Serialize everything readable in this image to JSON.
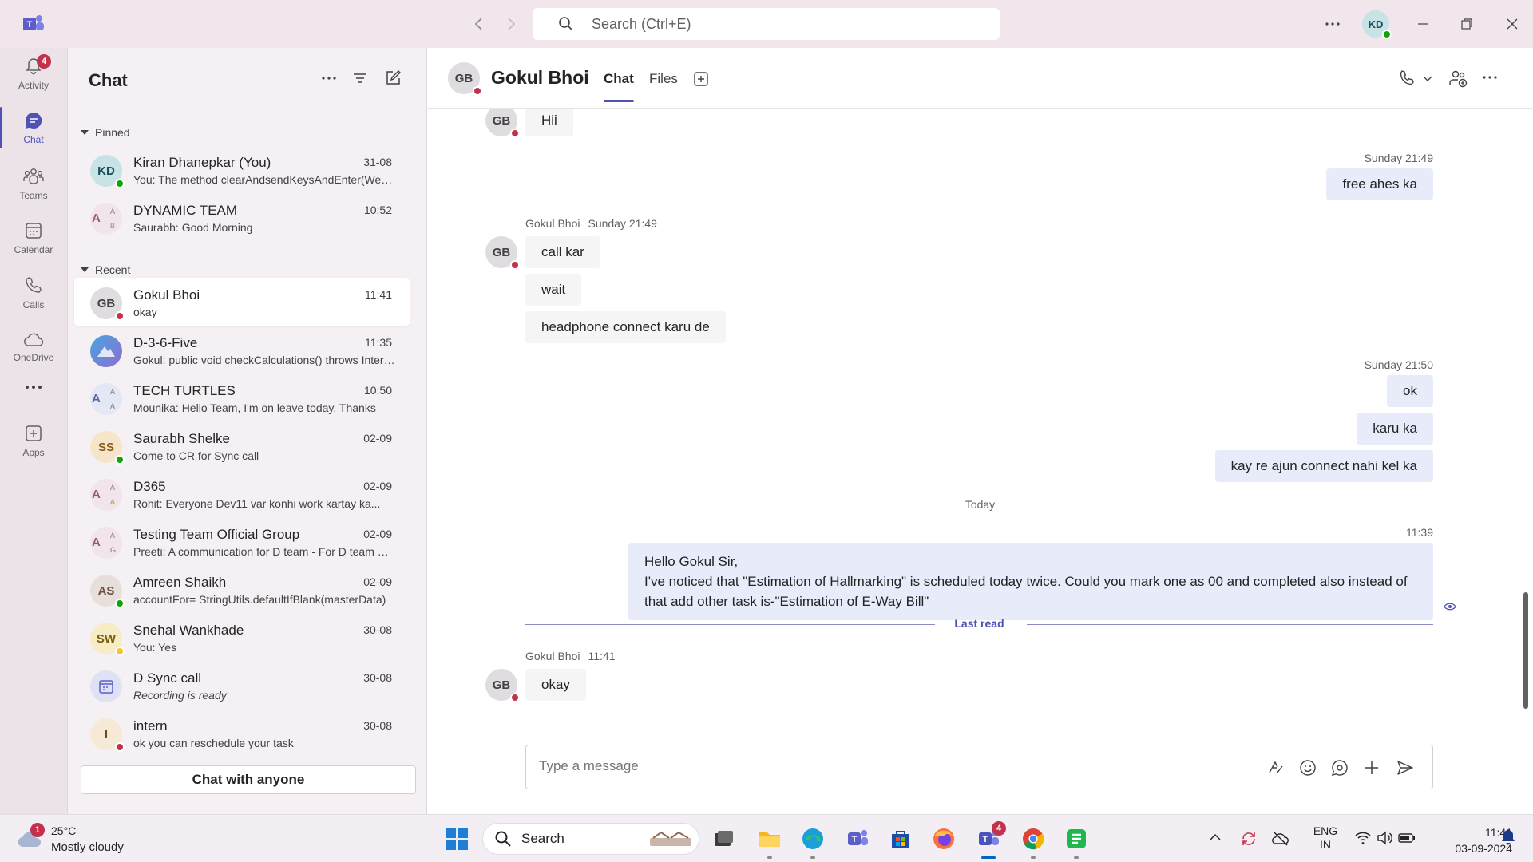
{
  "titlebar": {
    "search_placeholder": "Search (Ctrl+E)",
    "avatar_initials": "KD"
  },
  "rail": {
    "items": [
      {
        "label": "Activity",
        "badge": "4"
      },
      {
        "label": "Chat"
      },
      {
        "label": "Teams"
      },
      {
        "label": "Calendar"
      },
      {
        "label": "Calls"
      },
      {
        "label": "OneDrive"
      },
      {
        "label": "Apps"
      }
    ]
  },
  "chat_panel": {
    "title": "Chat",
    "pinned_label": "Pinned",
    "recent_label": "Recent",
    "pinned": [
      {
        "initials": "KD",
        "name": "Kiran Dhanepkar (You)",
        "time": "31-08",
        "preview": "You: The method clearAndsendKeysAndEnter(WebElement..."
      },
      {
        "initials": "A",
        "name": "DYNAMIC TEAM",
        "time": "10:52",
        "preview": "Saurabh: Good Morning"
      }
    ],
    "recent": [
      {
        "initials": "GB",
        "name": "Gokul Bhoi",
        "time": "11:41",
        "preview": "okay"
      },
      {
        "initials": "",
        "name": "D-3-6-Five",
        "time": "11:35",
        "preview": "Gokul: public void checkCalculations() throws InterruptedException"
      },
      {
        "initials": "A",
        "name": "TECH TURTLES",
        "time": "10:50",
        "preview": "Mounika: Hello Team, I'm on leave today. Thanks"
      },
      {
        "initials": "SS",
        "name": "Saurabh Shelke",
        "time": "02-09",
        "preview": "Come to CR for Sync call"
      },
      {
        "initials": "A",
        "name": "D365",
        "time": "02-09",
        "preview": "Rohit: Everyone Dev11 var konhi work kartay ka..."
      },
      {
        "initials": "A",
        "name": "Testing Team Official Group",
        "time": "02-09",
        "preview": "Preeti: A communication for D team - For D team members"
      },
      {
        "initials": "AS",
        "name": "Amreen Shaikh",
        "time": "02-09",
        "preview": "accountFor= StringUtils.defaultIfBlank(masterData)"
      },
      {
        "initials": "SW",
        "name": "Snehal Wankhade",
        "time": "30-08",
        "preview": "You: Yes"
      },
      {
        "initials": "",
        "name": "D Sync call",
        "time": "30-08",
        "preview": "Recording is ready"
      },
      {
        "initials": "I",
        "name": "intern",
        "time": "30-08",
        "preview": "ok you can reschedule your task"
      }
    ],
    "chat_with_anyone": "Chat with anyone"
  },
  "conversation": {
    "initials": "GB",
    "name": "Gokul Bhoi",
    "tabs": [
      "Chat",
      "Files"
    ],
    "messages": {
      "m1": "Hii",
      "meta2": "Sunday 21:49",
      "m2": "free ahes ka",
      "meta3_name": "Gokul Bhoi",
      "meta3_time": "Sunday 21:49",
      "m3": "call kar",
      "m4": "wait",
      "m5": "headphone connect karu de",
      "meta6": "Sunday 21:50",
      "m6": "ok",
      "m7": "karu ka",
      "m8": "kay re ajun connect nahi kel ka",
      "day_separator": "Today",
      "meta9": "11:39",
      "m9_line1": "Hello Gokul Sir,",
      "m9_line2": "I've noticed that \"Estimation of Hallmarking\" is scheduled today twice. Could you mark one as  00 and completed  also instead of that  add other task is-\"Estimation of E-Way Bill\"",
      "last_read": "Last read",
      "meta10_name": "Gokul Bhoi",
      "meta10_time": "11:41",
      "m10": "okay"
    },
    "composer_placeholder": "Type a message"
  },
  "taskbar": {
    "weather_badge": "1",
    "temp": "25°C",
    "condition": "Mostly cloudy",
    "search": "Search",
    "teams_badge": "4",
    "lang_line1": "ENG",
    "lang_line2": "IN",
    "time": "11:41",
    "date": "03-09-2024"
  },
  "colors": {
    "accent": "#4f52b2",
    "presence_available": "#13a10e",
    "presence_busy": "#c4314b",
    "presence_away": "#f8c234",
    "outgoing_bubble": "#e8ebfa"
  }
}
